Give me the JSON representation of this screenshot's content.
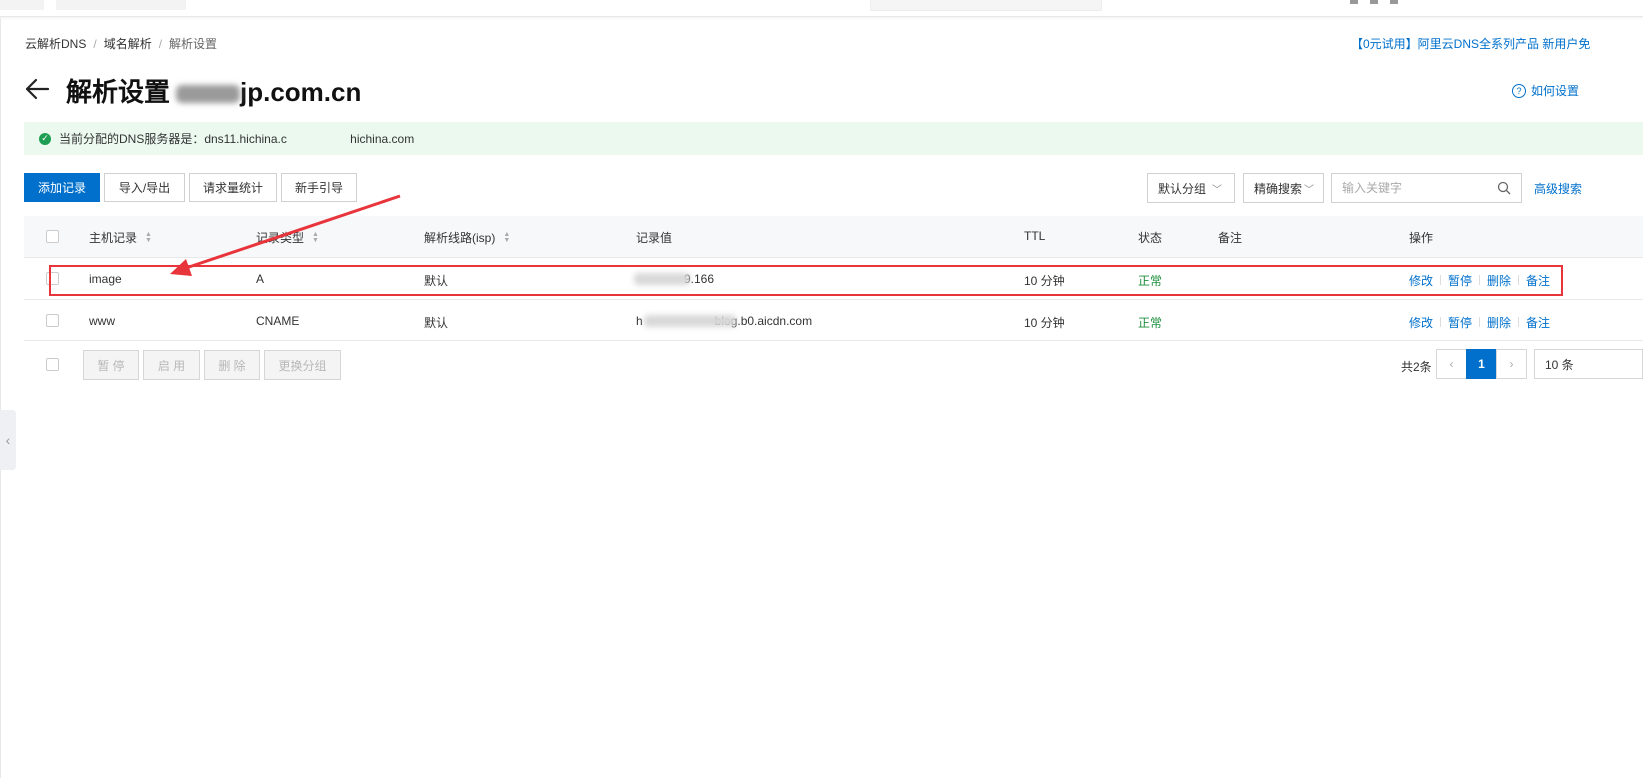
{
  "breadcrumb": {
    "root": "云解析DNS",
    "level2": "域名解析",
    "current": "解析设置",
    "sep": "/"
  },
  "promo": "【0元试用】阿里云DNS全系列产品 新用户免",
  "help": {
    "label": "如何设置"
  },
  "page": {
    "title": "解析设置",
    "domain_visible": "jp.com.cn"
  },
  "alert": {
    "text": "当前分配的DNS服务器是：dns11.hichina.c      hichina.com"
  },
  "toolbar": {
    "add_record": "添加记录",
    "import_export": "导入/导出",
    "request_stats": "请求量统计",
    "guide": "新手引导",
    "group_select": "默认分组",
    "search_mode": "精确搜索",
    "search_placeholder": "输入关键字",
    "advanced_search": "高级搜索"
  },
  "table": {
    "headers": {
      "host": "主机记录",
      "type": "记录类型",
      "line": "解析线路(isp)",
      "value": "记录值",
      "ttl": "TTL",
      "status": "状态",
      "remark": "备注",
      "actions": "操作"
    },
    "rows": [
      {
        "host": "image",
        "type": "A",
        "line": "默认",
        "value": "    9.166",
        "ttl": "10 分钟",
        "status": "正常",
        "remark": ""
      },
      {
        "host": "www",
        "type": "CNAME",
        "line": "默认",
        "value": "h      blog.b0.aicdn.com",
        "ttl": "10 分钟",
        "status": "正常",
        "remark": ""
      }
    ],
    "row_actions": {
      "edit": "修改",
      "pause": "暂停",
      "delete": "删除",
      "remark": "备注"
    }
  },
  "batch": {
    "pause": "暂 停",
    "enable": "启 用",
    "delete": "删 除",
    "change_group": "更换分组"
  },
  "pagination": {
    "total": "共2条",
    "current_page": "1",
    "page_size": "10 条"
  },
  "colors": {
    "accent": "#0070cc",
    "success": "#1e8e3e",
    "alert_bg": "#ebf9ef",
    "annotation": "#e8353b"
  },
  "icons": [
    "back-arrow-icon",
    "help-circle-icon",
    "check-circle-icon",
    "chevron-down-icon",
    "search-icon",
    "sort-icon",
    "chevron-left-icon",
    "chevron-right-icon"
  ]
}
